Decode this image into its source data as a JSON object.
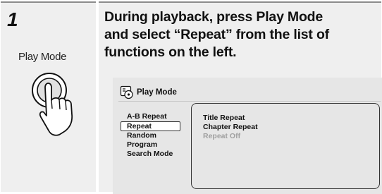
{
  "step": {
    "number": "1"
  },
  "button": {
    "label": "Play Mode",
    "icon": "hand-pressing-button-icon"
  },
  "instruction": {
    "line1": "During playback, press Play Mode",
    "line2": "and select “Repeat” from the list of",
    "line3": "functions on the left."
  },
  "osd": {
    "title": "Play Mode",
    "icon": "disc-settings-icon",
    "functions": [
      "A-B Repeat",
      "Repeat",
      "Random",
      "Program",
      "Search Mode"
    ],
    "selected_function": "Repeat",
    "options": [
      "Title Repeat",
      "Chapter Repeat",
      "Repeat Off"
    ],
    "disabled_option": "Repeat Off"
  }
}
